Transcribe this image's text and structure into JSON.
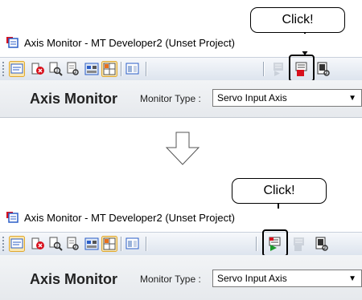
{
  "window": {
    "title": "Axis Monitor - MT Developer2 (Unset Project)"
  },
  "before": {
    "callout": "Click!",
    "monitor": {
      "title": "Axis Monitor",
      "type_label": "Monitor Type :",
      "type_value": "Servo Input Axis"
    }
  },
  "after": {
    "callout": "Click!",
    "monitor": {
      "title": "Axis Monitor",
      "type_label": "Monitor Type :",
      "type_value": "Servo Input Axis"
    }
  },
  "colors": {
    "highlight_red": "#d8101c",
    "play_green": "#1a9a2a",
    "accent_blue": "#2b5ec7"
  },
  "icons": [
    "axis-monitor-window-icon",
    "axis-monitor-icon",
    "error-monitor-icon",
    "search-monitor-icon",
    "detail-monitor-icon",
    "table-monitor-icon",
    "grid-monitor-icon",
    "panel-icon",
    "start-monitor-icon",
    "stop-monitor-icon",
    "settings-icon",
    "down-arrow-icon"
  ]
}
